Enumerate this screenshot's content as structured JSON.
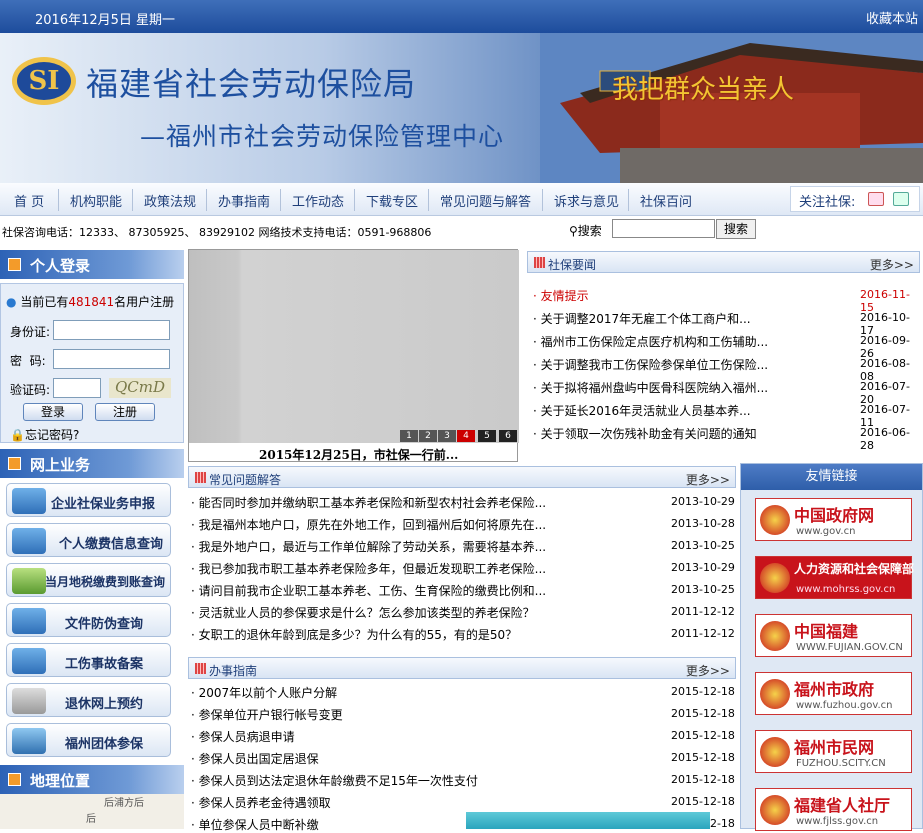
{
  "topbar": {
    "date": "2016年12月5日 星期一",
    "favorite": "收藏本站"
  },
  "banner": {
    "logo": "SI",
    "title": "福建省社会劳动保险局",
    "subtitle": "—福州市社会劳动保险管理中心",
    "slogan": "我把群众当亲人"
  },
  "nav": {
    "items": [
      "首 页",
      "机构职能",
      "政策法规",
      "办事指南",
      "工作动态",
      "下载专区",
      "常见问题与解答",
      "诉求与意见",
      "社保百问"
    ],
    "follow": "关注社保:"
  },
  "info": {
    "phone": "社保咨询电话：12333、 87305925、 83929102    网络技术支持电话：0591-968806",
    "search_label": "搜索",
    "search_button": "搜索"
  },
  "login": {
    "title": "个人登录",
    "reg_prefix": "当前已有",
    "reg_count": "481841",
    "reg_suffix": "名用户注册",
    "id_label": "身份证:",
    "pwd_label": "密  码:",
    "captcha_label": "验证码:",
    "captcha": "QCmD",
    "login_btn": "登录",
    "register_btn": "注册",
    "forgot": "忘记密码?"
  },
  "online": {
    "title": "网上业务",
    "items": [
      "企业社保业务申报",
      "个人缴费信息查询",
      "当月地税缴费到账查询",
      "文件防伪查询",
      "工伤事故备案",
      "退休网上预约",
      "福州团体参保"
    ]
  },
  "geo": {
    "title": "地理位置",
    "map_text": "后浦方后",
    "map_text2": "后"
  },
  "photo": {
    "caption": "2015年12月25日，市社保一行前...",
    "pages": [
      "1",
      "2",
      "3",
      "4",
      "5",
      "6"
    ]
  },
  "news": {
    "title": "社保要闻",
    "more": "更多>>",
    "items": [
      {
        "t": "友情提示",
        "d": "2016-11-15",
        "hl": true
      },
      {
        "t": "关于调整2017年无雇工个体工商户和...",
        "d": "2016-10-17"
      },
      {
        "t": "福州市工伤保险定点医疗机构和工伤辅助...",
        "d": "2016-09-26"
      },
      {
        "t": "关于调整我市工伤保险参保单位工伤保险...",
        "d": "2016-08-08"
      },
      {
        "t": "关于拟将福州盘屿中医骨科医院纳入福州...",
        "d": "2016-07-20"
      },
      {
        "t": "关于延长2016年灵活就业人员基本养...",
        "d": "2016-07-11"
      },
      {
        "t": "关于领取一次伤残补助金有关问题的通知",
        "d": "2016-06-28"
      }
    ]
  },
  "faq": {
    "title": "常见问题解答",
    "more": "更多>>",
    "items": [
      {
        "t": "能否同时参加并缴纳职工基本养老保险和新型农村社会养老保险...",
        "d": "2013-10-29"
      },
      {
        "t": "我是福州本地户口，原先在外地工作，回到福州后如何将原先在...",
        "d": "2013-10-28"
      },
      {
        "t": "我是外地户口，最近与工作单位解除了劳动关系，需要将基本养...",
        "d": "2013-10-25"
      },
      {
        "t": "我已参加我市职工基本养老保险多年，但最近发现职工养老保险...",
        "d": "2013-10-29"
      },
      {
        "t": "请问目前我市企业职工基本养老、工伤、生育保险的缴费比例和...",
        "d": "2013-10-25"
      },
      {
        "t": "灵活就业人员的参保要求是什么？怎么参加该类型的养老保险？",
        "d": "2011-12-12"
      },
      {
        "t": "女职工的退休年龄到底是多少？为什么有的55，有的是50？",
        "d": "2011-12-12"
      }
    ]
  },
  "guide": {
    "title": "办事指南",
    "more": "更多>>",
    "items": [
      {
        "t": "2007年以前个人账户分解",
        "d": "2015-12-18"
      },
      {
        "t": "参保单位开户银行帐号变更",
        "d": "2015-12-18"
      },
      {
        "t": "参保人员病退申请",
        "d": "2015-12-18"
      },
      {
        "t": "参保人员出国定居退保",
        "d": "2015-12-18"
      },
      {
        "t": "参保人员到达法定退休年龄缴费不足15年一次性支付",
        "d": "2015-12-18"
      },
      {
        "t": "参保人员养老金待遇领取",
        "d": "2015-12-18"
      },
      {
        "t": "单位参保人员中断补缴",
        "d": "2015-12-18"
      }
    ]
  },
  "links": {
    "title": "友情链接",
    "items": [
      {
        "n": "中国政府网",
        "u": "www.gov.cn"
      },
      {
        "n": "人力资源和社会保障部",
        "u": "www.mohrss.gov.cn"
      },
      {
        "n": "中国福建",
        "u": "WWW.FUJIAN.GOV.CN"
      },
      {
        "n": "福州市政府",
        "u": "www.fuzhou.gov.cn"
      },
      {
        "n": "福州市民网",
        "u": "FUZHOU.SCITY.CN"
      },
      {
        "n": "福建省人社厅",
        "u": "www.fjlss.gov.cn"
      }
    ]
  },
  "colors": {
    "brand": "#1d4f9f",
    "accent": "#f39b2a",
    "red": "#c8131b"
  }
}
